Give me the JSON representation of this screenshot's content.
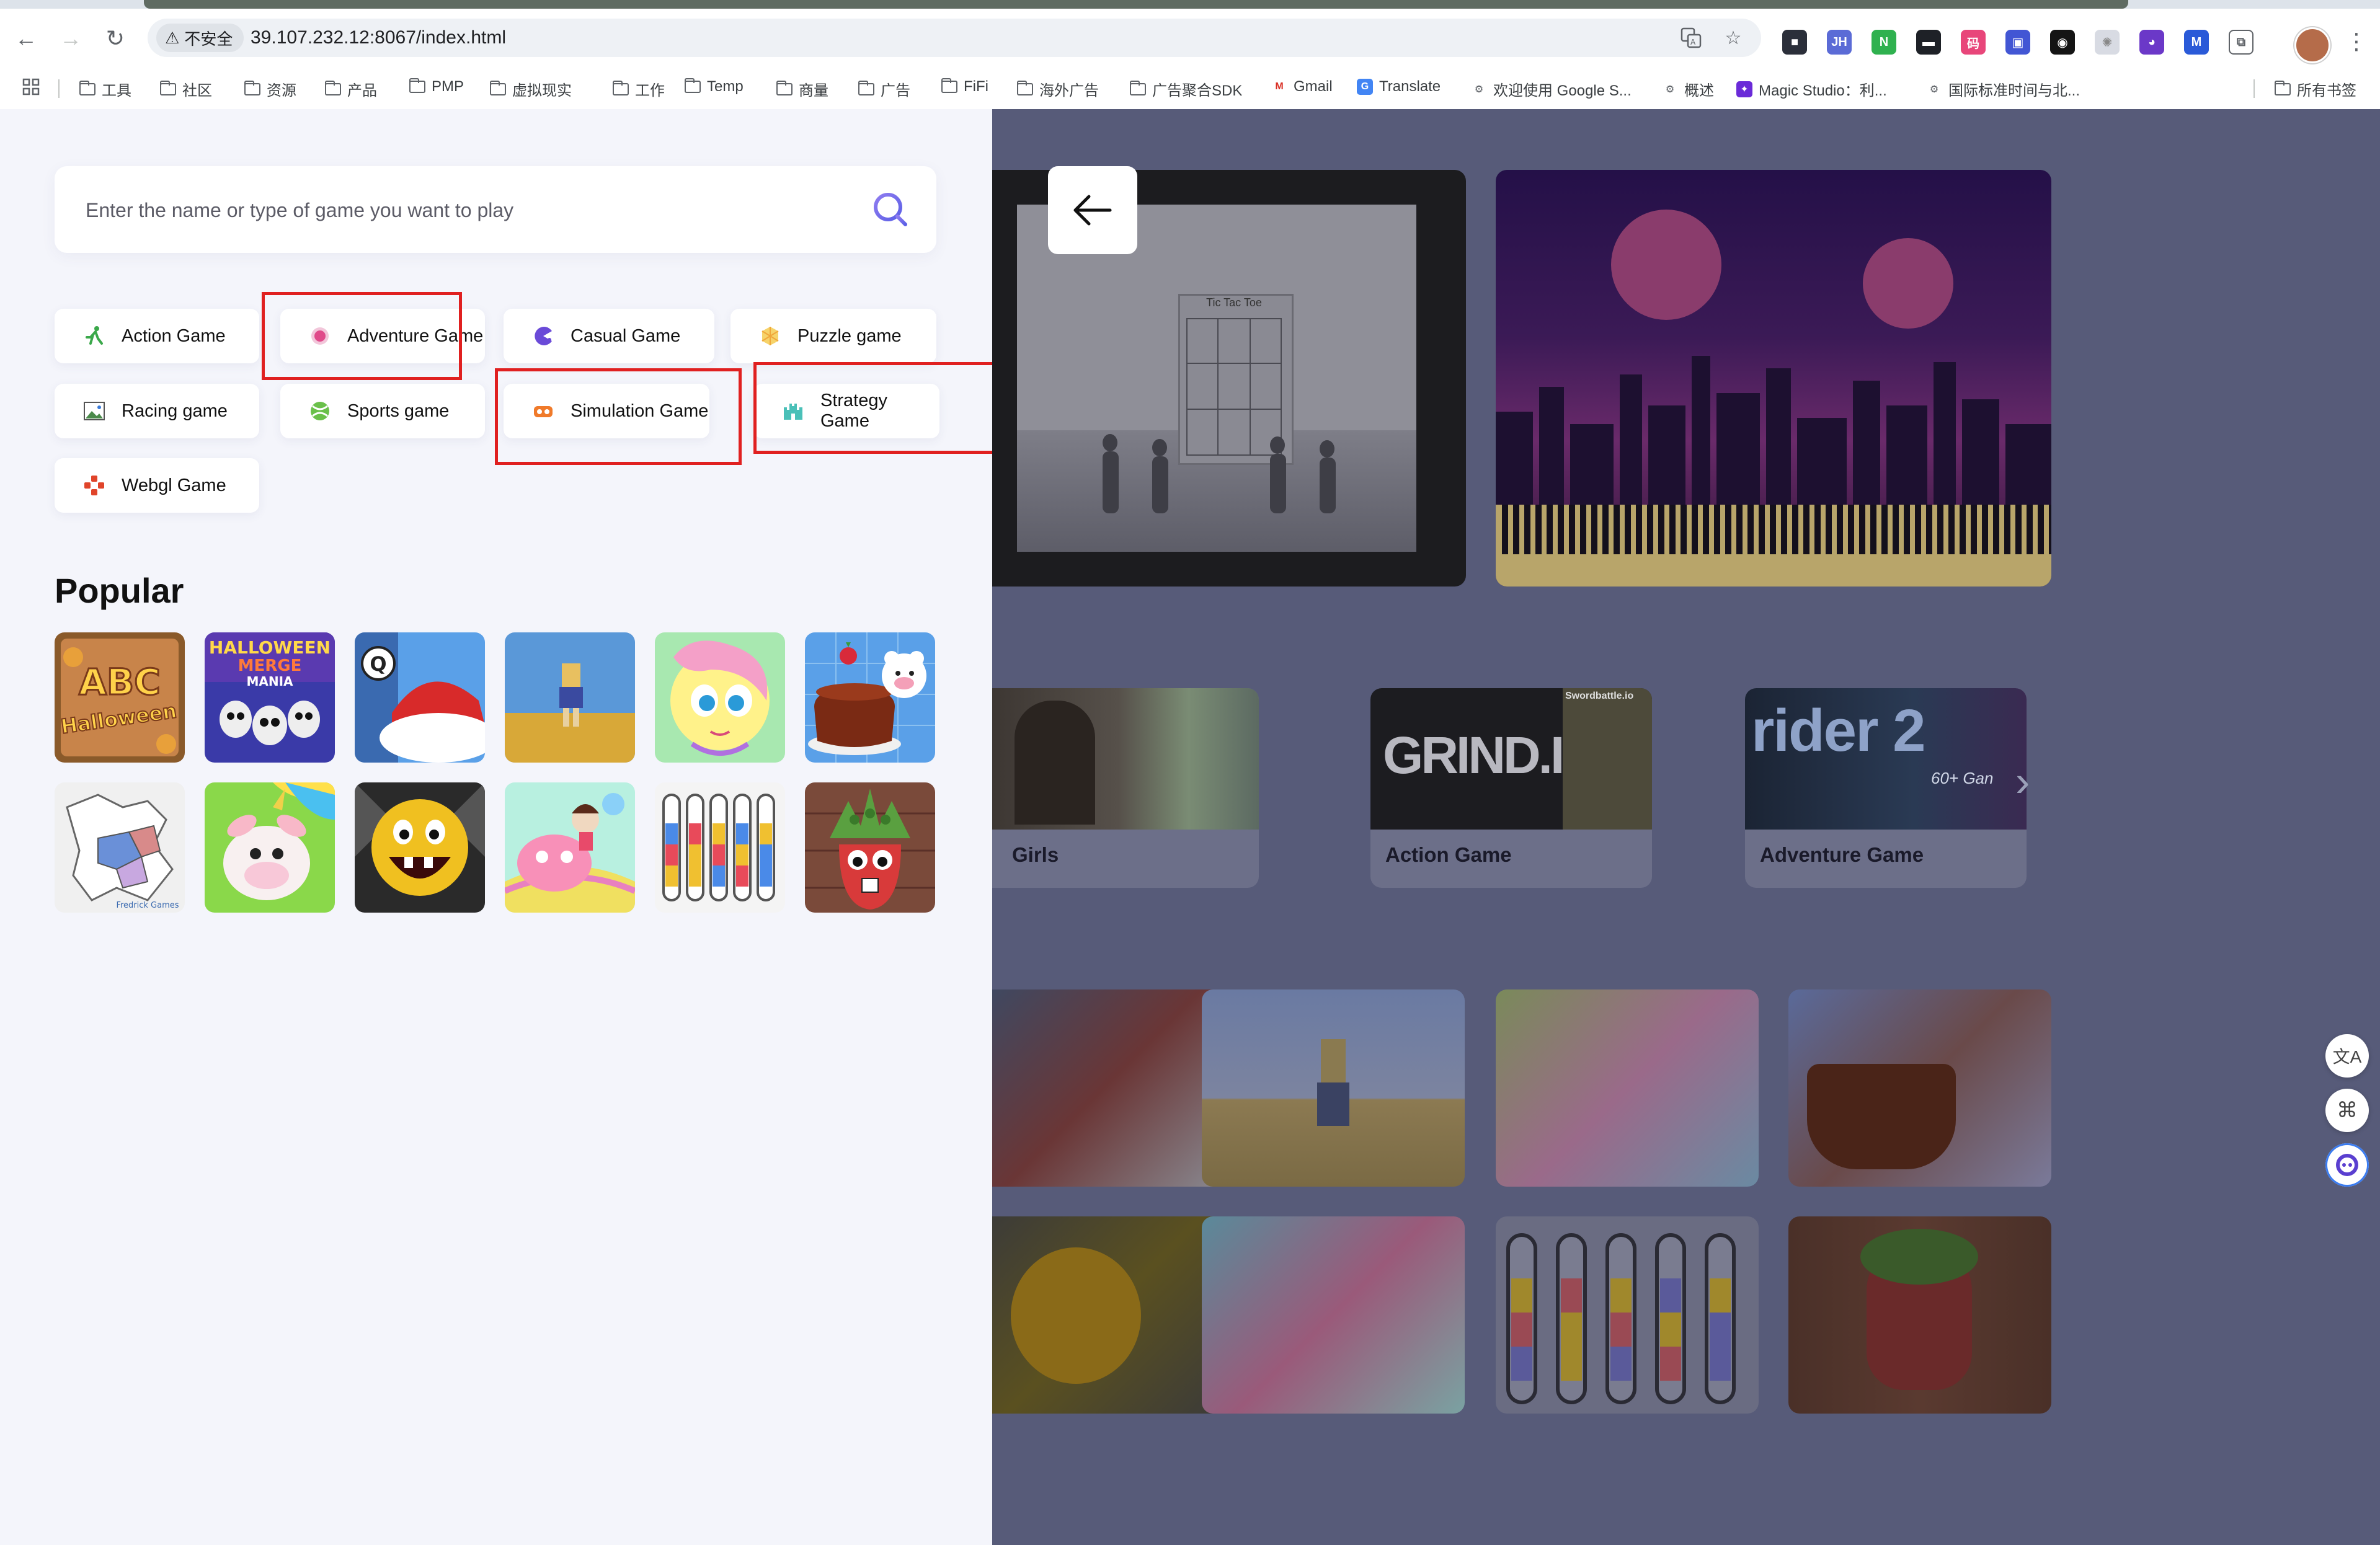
{
  "browser": {
    "insecure_label": "不安全",
    "url": "39.107.232.12:8067/index.html",
    "bookmarks": [
      {
        "label": "工具",
        "type": "folder"
      },
      {
        "label": "社区",
        "type": "folder"
      },
      {
        "label": "资源",
        "type": "folder"
      },
      {
        "label": "产品",
        "type": "folder"
      },
      {
        "label": "PMP",
        "type": "folder"
      },
      {
        "label": "虚拟现实",
        "type": "folder"
      },
      {
        "label": "工作",
        "type": "folder"
      },
      {
        "label": "Temp",
        "type": "folder"
      },
      {
        "label": "商量",
        "type": "folder"
      },
      {
        "label": "广告",
        "type": "folder"
      },
      {
        "label": "FiFi",
        "type": "folder"
      },
      {
        "label": "海外广告",
        "type": "folder"
      },
      {
        "label": "广告聚合SDK",
        "type": "folder"
      },
      {
        "label": "Gmail",
        "type": "gmail"
      },
      {
        "label": "Translate",
        "type": "translate"
      },
      {
        "label": "欢迎使用 Google S...",
        "type": "page"
      },
      {
        "label": "概述",
        "type": "page"
      },
      {
        "label": "Magic Studio：利...",
        "type": "magic"
      },
      {
        "label": "国际标准时间与北...",
        "type": "page"
      }
    ],
    "all_bookmarks": "所有书签",
    "colors": {
      "omnibox": "#eef1f5",
      "highlight": "#e02020"
    }
  },
  "search": {
    "placeholder": "Enter the name or type of game you want to play"
  },
  "categories": [
    {
      "label": "Action Game",
      "icon": "running-figure-icon"
    },
    {
      "label": "Adventure Game",
      "icon": "compass-icon"
    },
    {
      "label": "Casual Game",
      "icon": "pacman-icon"
    },
    {
      "label": "Puzzle game",
      "icon": "puzzle-icon"
    },
    {
      "label": "Racing game",
      "icon": "image-icon"
    },
    {
      "label": "Sports game",
      "icon": "ball-icon"
    },
    {
      "label": "Simulation Game",
      "icon": "vr-goggles-icon"
    },
    {
      "label": "Strategy Game",
      "icon": "castle-icon"
    },
    {
      "label": "Webgl Game",
      "icon": "cross-icon"
    }
  ],
  "popular": {
    "title": "Popular",
    "thumbs": [
      {
        "name": "abc-halloween",
        "text": "ABC Halloween"
      },
      {
        "name": "halloween-merge-mania",
        "text": "HALLOWEEN MERGE MANIA"
      },
      {
        "name": "santa-hat"
      },
      {
        "name": "pixel-walker"
      },
      {
        "name": "pony-cartoon"
      },
      {
        "name": "cake-panda"
      },
      {
        "name": "map-puzzle",
        "text": "Fredrick Games"
      },
      {
        "name": "unicorn-cow"
      },
      {
        "name": "yellow-ball-monster"
      },
      {
        "name": "baby-cake-ride"
      },
      {
        "name": "water-sort"
      },
      {
        "name": "strawberry-monster"
      }
    ]
  },
  "background": {
    "hero_left_title": "Tic Tac Toe",
    "category_cards": [
      {
        "label": "Girls"
      },
      {
        "label": "Action Game",
        "art_text": "GRIND.IO",
        "sub_text": "Swordbattle.io"
      },
      {
        "label": "Adventure Game",
        "art_text": "rider 2",
        "sub_text": "60+ Gan"
      }
    ]
  }
}
